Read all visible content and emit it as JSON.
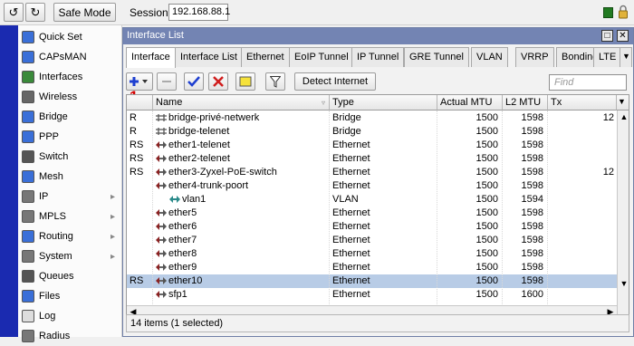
{
  "toolbar": {
    "safe_mode_label": "Safe Mode",
    "session_label": "Session:",
    "session_value": "192.168.88.1"
  },
  "sidebar": {
    "items": [
      {
        "label": "Quick Set",
        "icon": "quickset-icon",
        "submenu": false
      },
      {
        "label": "CAPsMAN",
        "icon": "capsman-icon",
        "submenu": false
      },
      {
        "label": "Interfaces",
        "icon": "interfaces-icon",
        "submenu": false
      },
      {
        "label": "Wireless",
        "icon": "wireless-icon",
        "submenu": false
      },
      {
        "label": "Bridge",
        "icon": "bridge-icon",
        "submenu": false
      },
      {
        "label": "PPP",
        "icon": "ppp-icon",
        "submenu": false
      },
      {
        "label": "Switch",
        "icon": "switch-icon",
        "submenu": false
      },
      {
        "label": "Mesh",
        "icon": "mesh-icon",
        "submenu": false
      },
      {
        "label": "IP",
        "icon": "ip-icon",
        "submenu": true
      },
      {
        "label": "MPLS",
        "icon": "mpls-icon",
        "submenu": true
      },
      {
        "label": "Routing",
        "icon": "routing-icon",
        "submenu": true
      },
      {
        "label": "System",
        "icon": "system-icon",
        "submenu": true
      },
      {
        "label": "Queues",
        "icon": "queues-icon",
        "submenu": false
      },
      {
        "label": "Files",
        "icon": "files-icon",
        "submenu": false
      },
      {
        "label": "Log",
        "icon": "log-icon",
        "submenu": false
      },
      {
        "label": "Radius",
        "icon": "radius-icon",
        "submenu": false
      }
    ]
  },
  "window": {
    "title": "Interface List",
    "tabs": [
      "Interface",
      "Interface List",
      "Ethernet",
      "EoIP Tunnel",
      "IP Tunnel",
      "GRE Tunnel",
      "VLAN",
      "VRRP",
      "Bonding",
      "LTE"
    ],
    "active_tab": "Interface",
    "detect_internet_label": "Detect Internet",
    "find_placeholder": "Find",
    "callout_number": "1",
    "columns": [
      "",
      "Name",
      "Type",
      "Actual MTU",
      "L2 MTU",
      "Tx"
    ],
    "rows": [
      {
        "flags": "R",
        "name": "bridge-privé-netwerk",
        "type": "Bridge",
        "mtu": "1500",
        "l2mtu": "1598",
        "tx": "12",
        "icon": "bridge-icon",
        "indent": false,
        "selected": false
      },
      {
        "flags": "R",
        "name": "bridge-telenet",
        "type": "Bridge",
        "mtu": "1500",
        "l2mtu": "1598",
        "tx": "",
        "icon": "bridge-icon",
        "indent": false,
        "selected": false
      },
      {
        "flags": "RS",
        "name": "ether1-telenet",
        "type": "Ethernet",
        "mtu": "1500",
        "l2mtu": "1598",
        "tx": "",
        "icon": "ethernet-icon",
        "indent": false,
        "selected": false
      },
      {
        "flags": "RS",
        "name": "ether2-telenet",
        "type": "Ethernet",
        "mtu": "1500",
        "l2mtu": "1598",
        "tx": "",
        "icon": "ethernet-icon",
        "indent": false,
        "selected": false
      },
      {
        "flags": "RS",
        "name": "ether3-Zyxel-PoE-switch",
        "type": "Ethernet",
        "mtu": "1500",
        "l2mtu": "1598",
        "tx": "12",
        "icon": "ethernet-icon",
        "indent": false,
        "selected": false
      },
      {
        "flags": "",
        "name": "ether4-trunk-poort",
        "type": "Ethernet",
        "mtu": "1500",
        "l2mtu": "1598",
        "tx": "",
        "icon": "ethernet-icon",
        "indent": false,
        "selected": false
      },
      {
        "flags": "",
        "name": "vlan1",
        "type": "VLAN",
        "mtu": "1500",
        "l2mtu": "1594",
        "tx": "",
        "icon": "vlan-icon",
        "indent": true,
        "selected": false
      },
      {
        "flags": "",
        "name": "ether5",
        "type": "Ethernet",
        "mtu": "1500",
        "l2mtu": "1598",
        "tx": "",
        "icon": "ethernet-icon",
        "indent": false,
        "selected": false
      },
      {
        "flags": "",
        "name": "ether6",
        "type": "Ethernet",
        "mtu": "1500",
        "l2mtu": "1598",
        "tx": "",
        "icon": "ethernet-icon",
        "indent": false,
        "selected": false
      },
      {
        "flags": "",
        "name": "ether7",
        "type": "Ethernet",
        "mtu": "1500",
        "l2mtu": "1598",
        "tx": "",
        "icon": "ethernet-icon",
        "indent": false,
        "selected": false
      },
      {
        "flags": "",
        "name": "ether8",
        "type": "Ethernet",
        "mtu": "1500",
        "l2mtu": "1598",
        "tx": "",
        "icon": "ethernet-icon",
        "indent": false,
        "selected": false
      },
      {
        "flags": "",
        "name": "ether9",
        "type": "Ethernet",
        "mtu": "1500",
        "l2mtu": "1598",
        "tx": "",
        "icon": "ethernet-icon",
        "indent": false,
        "selected": false
      },
      {
        "flags": "RS",
        "name": "ether10",
        "type": "Ethernet",
        "mtu": "1500",
        "l2mtu": "1598",
        "tx": "",
        "icon": "ethernet-icon",
        "indent": false,
        "selected": true
      },
      {
        "flags": "",
        "name": "sfp1",
        "type": "Ethernet",
        "mtu": "1500",
        "l2mtu": "1600",
        "tx": "",
        "icon": "ethernet-icon",
        "indent": false,
        "selected": false
      }
    ],
    "status": "14 items (1 selected)"
  },
  "colors": {
    "title_bar": "#7384b3",
    "selection": "#b8cce6",
    "callout": "#d40000",
    "add_button": "#1e3fd0",
    "apply_check": "#1e3fd0",
    "cancel_x": "#d01e1e"
  }
}
